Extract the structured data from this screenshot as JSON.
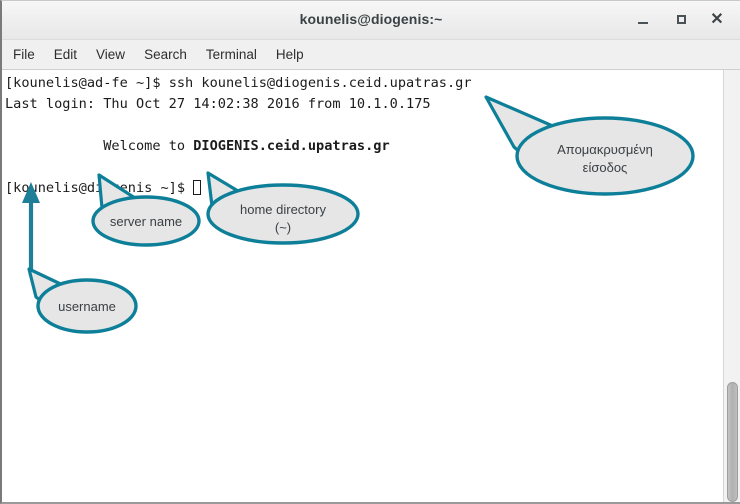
{
  "window": {
    "title": "kounelis@diogenis:~",
    "controls": [
      {
        "name": "minimize",
        "label": "–"
      },
      {
        "name": "maximize",
        "label": "□"
      },
      {
        "name": "close",
        "label": "✕"
      }
    ]
  },
  "menu": {
    "items": [
      {
        "label": "File"
      },
      {
        "label": "Edit"
      },
      {
        "label": "View"
      },
      {
        "label": "Search"
      },
      {
        "label": "Terminal"
      },
      {
        "label": "Help"
      }
    ]
  },
  "terminal": {
    "lines": {
      "line1_prompt": "[kounelis@ad-fe ~]$ ",
      "line1_command": "ssh kounelis@diogenis.ceid.upatras.gr",
      "line2": "Last login: Thu Oct 27 14:02:38 2016 from 10.1.0.175",
      "line3_blank": "",
      "line4_indent": "            ",
      "line4_welcome": "Welcome to ",
      "line4_host": "DIOGENIS.ceid.upatras.gr",
      "line5_blank": "",
      "line6_prompt": "[kounelis@diogenis ~]$ "
    },
    "cursor": "block-outline"
  },
  "scrollbar": {
    "orientation": "vertical",
    "thumb_position": "near-bottom"
  },
  "annotations": [
    {
      "id": "remote-login",
      "text_line1": "Απομακρυσμένη",
      "text_line2": "είσοδος"
    },
    {
      "id": "server-name",
      "text_line1": "server name",
      "text_line2": ""
    },
    {
      "id": "home-directory",
      "text_line1": "home directory",
      "text_line2": "(~)"
    },
    {
      "id": "username",
      "text_line1": "username",
      "text_line2": ""
    }
  ],
  "colors": {
    "accent_teal": "#0e7f99",
    "callout_fill": "#e6e6e6",
    "terminal_fg": "#1b1b1b",
    "terminal_bg": "#ffffff",
    "titlebar_bg": "#eeeeee"
  }
}
